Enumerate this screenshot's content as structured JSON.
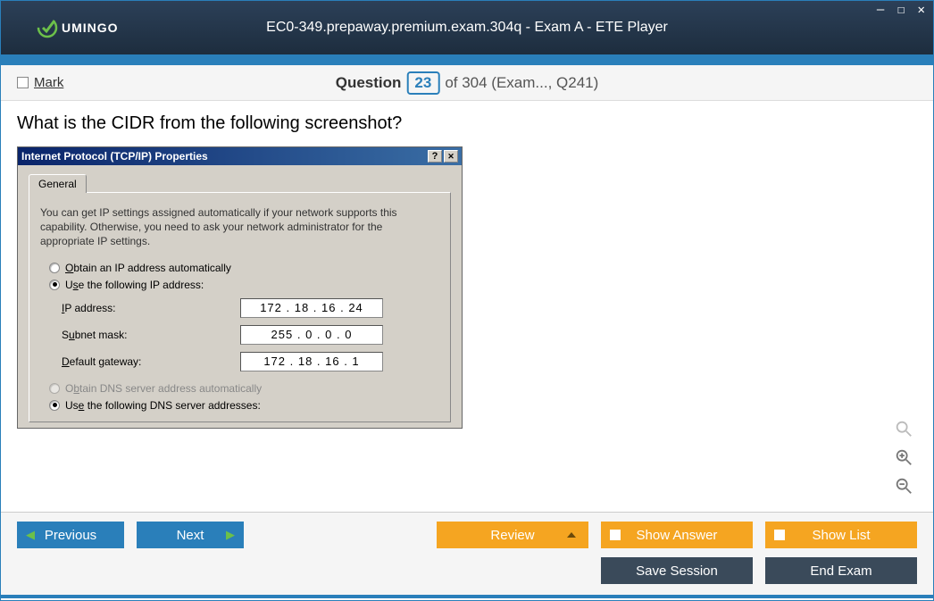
{
  "titlebar": {
    "logo_text": "UMINGO",
    "title": "EC0-349.prepaway.premium.exam.304q - Exam A - ETE Player",
    "win_btns": "—  ☐  ✕"
  },
  "qbar": {
    "mark_label": "Mark",
    "question_word": "Question",
    "current": "23",
    "suffix": "of 304 (Exam..., Q241)"
  },
  "question": {
    "text": "What is the CIDR from the following screenshot?"
  },
  "tcpip": {
    "title": "Internet Protocol (TCP/IP) Properties",
    "help_btn": "?",
    "close_btn": "✕",
    "tab": "General",
    "description": "You can get IP settings assigned automatically if your network supports this capability. Otherwise, you need to ask your network administrator for the appropriate IP settings.",
    "radio_auto": "Obtain an IP address automatically",
    "radio_manual": "Use the following IP address:",
    "ip_label": "IP address:",
    "ip_value": "172 . 18 . 16 . 24",
    "subnet_label": "Subnet mask:",
    "subnet_value": "255 .  0  .  0  .  0",
    "gateway_label": "Default gateway:",
    "gateway_value": "172 . 18 . 16 .  1",
    "dns_auto": "Obtain DNS server address automatically",
    "dns_manual": "Use the following DNS server addresses:"
  },
  "footer": {
    "previous": "Previous",
    "next": "Next",
    "review": "Review",
    "show_answer": "Show Answer",
    "show_list": "Show List",
    "save_session": "Save Session",
    "end_exam": "End Exam"
  }
}
